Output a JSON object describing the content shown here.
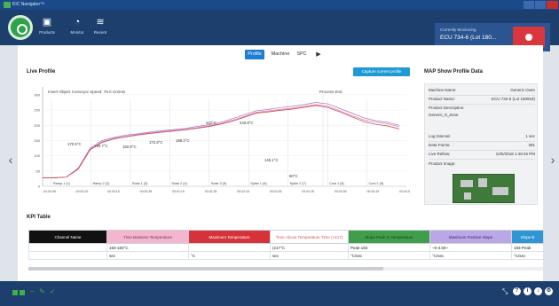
{
  "window": {
    "title": "KIC Navigator™"
  },
  "nav": [
    {
      "label": "Products",
      "icon": "box-icon"
    },
    {
      "label": "Monitor",
      "icon": "gauge-icon"
    },
    {
      "label": "Recent",
      "icon": "chart-icon"
    }
  ],
  "monitoring": {
    "title": "Currently Monitoring",
    "value": "ECU 734-6 (Lot 180..."
  },
  "tabs": {
    "profile": "Profile",
    "machine": "Machine",
    "spc": "SPC",
    "play": "▶"
  },
  "live_profile": {
    "title": "Live Profile",
    "capture_button": "Capture current profile",
    "conveyor_note": "Insert Object Conveyor Speed: 78.0 cm/min",
    "process_end": "Process End"
  },
  "chart_data": {
    "type": "line",
    "ylim": [
      0,
      320
    ],
    "yticks": [
      0,
      50,
      100,
      150,
      200,
      250,
      300
    ],
    "xtick_labels": [
      "-00:00:35",
      "-00:00:15",
      "00:00:15",
      "00:00:35",
      "00:01:15",
      "00:01:35",
      "00:02:15",
      "00:02:35",
      "00:03:15",
      "00:03:35",
      "00:04:15",
      "00:04:35"
    ],
    "zones": [
      "Ramp 1 (1)",
      "Ramp 2 (2)",
      "Soak 1 (3)",
      "Soak 2 (4)",
      "Soak 3 (5)",
      "Spike 1 (6)",
      "Spike 2 (7)",
      "Cool 1 (8)",
      "Cool 2 (9)"
    ],
    "annotations": [
      "170.5°C",
      "190.7°C",
      "182.8°C",
      "172.8°C",
      "198.2°C",
      "242°C",
      "240.8°C",
      "140.1°C",
      "50°C"
    ],
    "series": [
      {
        "color": "#9a6fcf",
        "values": [
          28,
          28,
          30,
          60,
          125,
          150,
          160,
          168,
          172,
          178,
          182,
          186,
          190,
          196,
          202,
          210,
          222,
          235,
          248,
          252,
          258,
          262,
          268,
          275,
          270,
          255,
          240,
          225,
          215,
          210,
          200
        ]
      },
      {
        "color": "#e27aa5",
        "values": [
          28,
          28,
          30,
          58,
          122,
          146,
          157,
          164,
          170,
          175,
          179,
          183,
          187,
          192,
          198,
          206,
          217,
          230,
          243,
          247,
          252,
          256,
          262,
          268,
          262,
          248,
          232,
          218,
          210,
          205,
          195
        ]
      },
      {
        "color": "#c23a3a",
        "values": [
          28,
          28,
          30,
          56,
          120,
          144,
          155,
          162,
          168,
          173,
          177,
          181,
          185,
          190,
          196,
          204,
          214,
          227,
          240,
          244,
          249,
          253,
          259,
          265,
          258,
          244,
          228,
          212,
          203,
          198,
          188
        ]
      }
    ]
  },
  "map_panel": {
    "title": "MAP Show Profile Data",
    "rows": [
      {
        "k": "Machine Name:",
        "v": "Generic Oven"
      },
      {
        "k": "Product Name:",
        "v": "ECU 734-6 (Lot 180918)"
      },
      {
        "k": "Product Description:",
        "v": ""
      },
      {
        "k": "Generic_8_Zone",
        "v": ""
      },
      {
        "k": "Log Interval:",
        "v": "1 sec"
      },
      {
        "k": "Data Points:",
        "v": "391"
      },
      {
        "k": "Live Reflow:",
        "v": "12/5/2018 1:48:46 PM"
      },
      {
        "k": "Product Image:",
        "v": ""
      }
    ]
  },
  "kpi": {
    "title": "KPI Table",
    "headers": [
      {
        "label": "Channel Name",
        "bg": "#111111",
        "fg": "#ffffff"
      },
      {
        "label": "Time Between Temperature",
        "bg": "#f2b6cf",
        "fg": "#8a2a55"
      },
      {
        "label": "Maximum Temperature",
        "bg": "#d6323a",
        "fg": "#ffffff"
      },
      {
        "label": "Time Above Temperature Time (>217)",
        "bg": "#ffffff",
        "fg": "#e05050"
      },
      {
        "label": "Slope Peak to Temperature",
        "bg": "#3f9e4c",
        "fg": "#1a3a1a"
      },
      {
        "label": "Maximum Positive Slope",
        "bg": "#b9a7e6",
        "fg": "#3a2a66"
      },
      {
        "label": "Slope B",
        "bg": "#2f96d3",
        "fg": "#ffffff"
      }
    ],
    "rows": [
      [
        "",
        "150-183°C",
        "",
        "(217°C",
        "Peak-183",
        "~0-3.50~",
        "183-Peak"
      ],
      [
        "",
        "sec",
        "°C",
        "sec",
        "°C/sec",
        "°C/sec",
        "°C/sec"
      ]
    ]
  },
  "footer": {
    "icons": [
      "grid-icon",
      "pencil-icon",
      "checkmark-icon"
    ]
  }
}
